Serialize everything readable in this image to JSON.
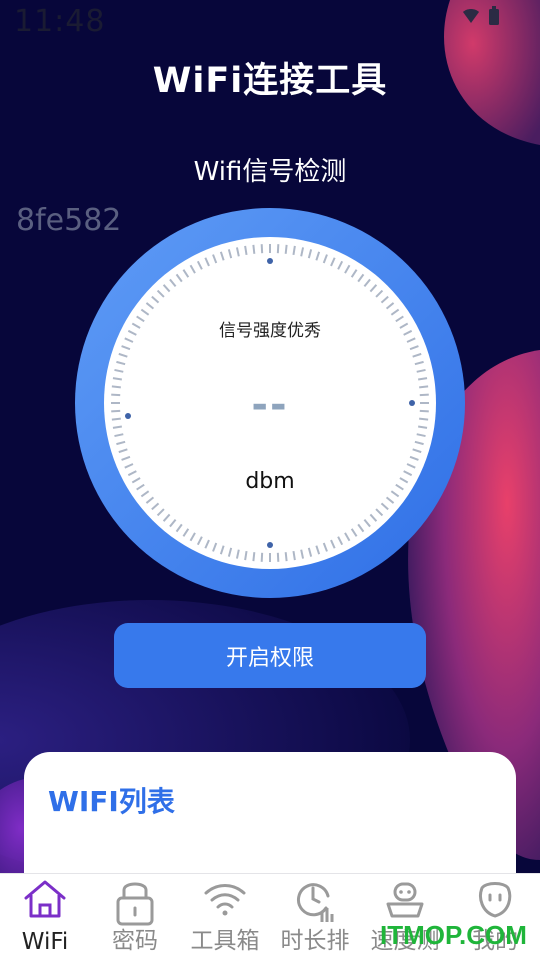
{
  "status_bar": {
    "time": "11:48"
  },
  "header": {
    "title": "WiFi连接工具"
  },
  "signal": {
    "section_title": "Wifi信号检测",
    "device_id": "8fe582",
    "quality_label": "信号强度优秀",
    "value": "--",
    "unit": "dbm"
  },
  "permission_button": {
    "label": "开启权限"
  },
  "wifi_list": {
    "title": "WIFI列表"
  },
  "tabs": [
    {
      "label": "WiFi",
      "icon": "home-icon",
      "active": true
    },
    {
      "label": "密码",
      "icon": "lock-icon",
      "active": false
    },
    {
      "label": "工具箱",
      "icon": "wifi-icon",
      "active": false
    },
    {
      "label": "时长排",
      "icon": "clock-chart-icon",
      "active": false
    },
    {
      "label": "速度测",
      "icon": "speed-icon",
      "active": false
    },
    {
      "label": "我的",
      "icon": "profile-icon",
      "active": false
    }
  ],
  "watermark": "ITMOP.COM",
  "colors": {
    "background": "#07063a",
    "accent": "#3779ec",
    "active_tab": "#7b2fc8",
    "list_title": "#2f6fe8"
  }
}
